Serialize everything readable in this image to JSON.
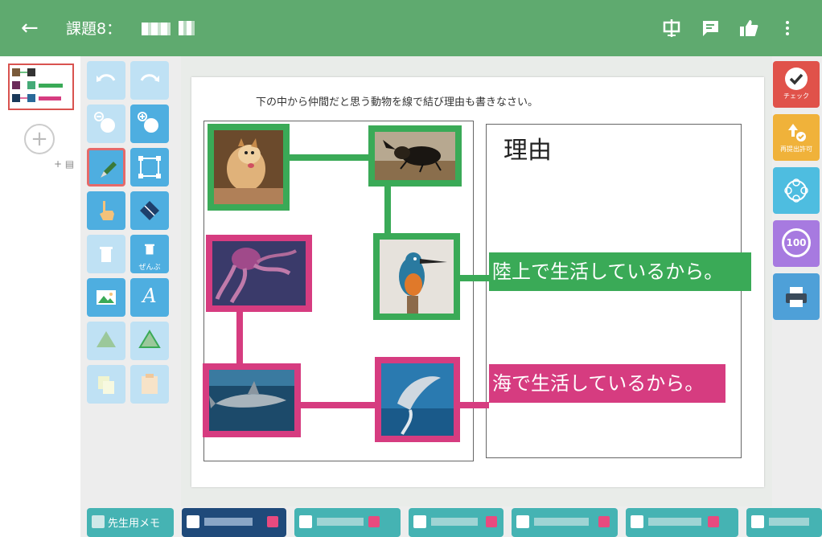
{
  "topbar": {
    "title": "課題8：",
    "back_icon": "arrow-left-icon",
    "icons": [
      "chinese-character-icon",
      "comment-icon",
      "thumbs-up-icon",
      "more-vert-icon"
    ]
  },
  "pages": {
    "add_label": "+",
    "plus_box": "+ ▤"
  },
  "tools": [
    {
      "name": "undo-icon"
    },
    {
      "name": "redo-icon"
    },
    {
      "name": "zoom-out-icon"
    },
    {
      "name": "zoom-in-icon"
    },
    {
      "name": "pen-icon"
    },
    {
      "name": "select-rect-icon"
    },
    {
      "name": "hand-icon"
    },
    {
      "name": "eraser-icon"
    },
    {
      "name": "trash-icon"
    },
    {
      "name": "trash-all-icon",
      "label": "ぜんぶ"
    },
    {
      "name": "image-icon"
    },
    {
      "name": "text-icon",
      "label": "A"
    }
  ],
  "worksheet": {
    "instruction": "下の中から仲間だと思う動物を線で結び理由も書きなさい。",
    "reason_title": "理由",
    "reason_land": "陸上で生活しているから。",
    "reason_sea": "海で生活しているから。",
    "animals": [
      "dog",
      "beetle",
      "kingfisher",
      "octopus",
      "shark",
      "dolphin"
    ]
  },
  "right_panel": {
    "check_label": "チェック",
    "resubmit_label": "再提出許可",
    "score_label": "100"
  },
  "bottom": {
    "teacher_memo": "先生用メモ"
  },
  "colors": {
    "topbar": "#5faa6f",
    "green": "#3aaa57",
    "pink": "#d63c80",
    "tool_blue": "#4eaee0"
  }
}
